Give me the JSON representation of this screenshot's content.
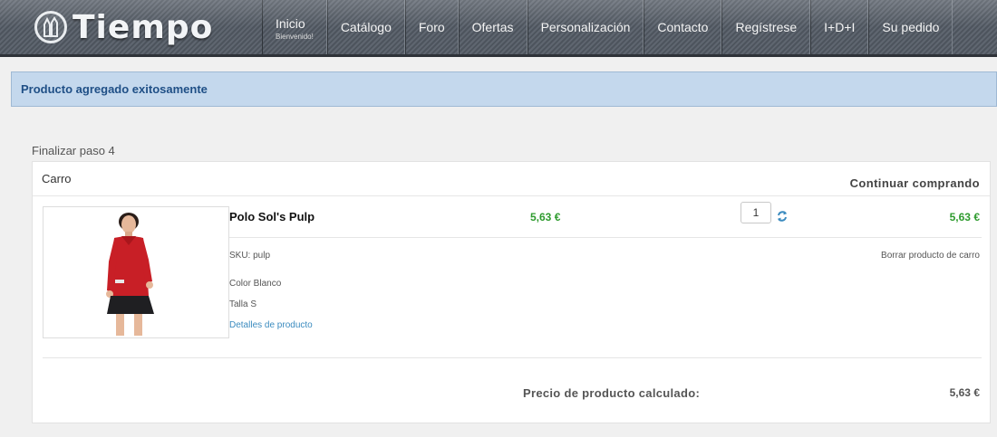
{
  "header": {
    "logo_text": "Tiempo",
    "nav": [
      {
        "label": "Inicio",
        "sub": "Bienvenido!"
      },
      {
        "label": "Catálogo"
      },
      {
        "label": "Foro"
      },
      {
        "label": "Ofertas"
      },
      {
        "label": "Personalización"
      },
      {
        "label": "Contacto"
      },
      {
        "label": "Regístrese"
      },
      {
        "label": "I+D+I"
      },
      {
        "label": "Su pedido"
      }
    ]
  },
  "alert": {
    "message": "Producto agregado exitosamente"
  },
  "step": {
    "label": "Finalizar paso 4"
  },
  "cart": {
    "title": "Carro",
    "continue_label": "Continuar comprando",
    "item": {
      "name": "Polo Sol's Pulp",
      "unit_price": "5,63 €",
      "quantity": "1",
      "total_price": "5,63 €",
      "sku": "SKU: pulp",
      "color": "Color Blanco",
      "size": "Talla S",
      "details_link": "Detalles de producto",
      "remove_label": "Borrar producto de carro"
    },
    "calculated_label": "Precio de producto calculado:",
    "calculated_value": "5,63 €"
  },
  "colors": {
    "accent_green": "#2e9b2e",
    "alert_bg": "#c4d8ed",
    "alert_text": "#1f4f86",
    "link": "#3b8bbf"
  },
  "icons": {
    "refresh": "refresh-icon",
    "logo": "logo-icon"
  }
}
